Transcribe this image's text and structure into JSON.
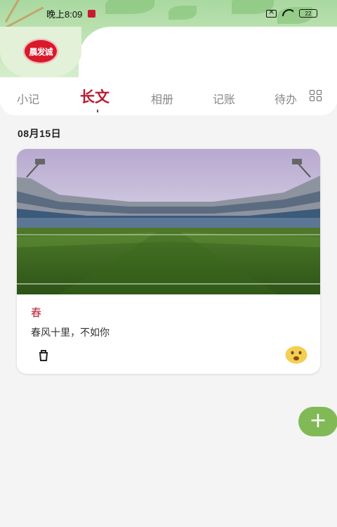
{
  "status_bar": {
    "time": "晚上8:09",
    "battery": "22"
  },
  "app": {
    "logo_text": "晨发诚"
  },
  "tabs": [
    {
      "label": "小记"
    },
    {
      "label": "长文"
    },
    {
      "label": "相册"
    },
    {
      "label": "记账"
    },
    {
      "label": "待办"
    }
  ],
  "active_tab": "长文",
  "entries": {
    "date": "08月15日",
    "items": [
      {
        "title": "春",
        "body": "春风十里，不如你",
        "image": "soccer-stadium-photo",
        "mood_icon": "smiling-face-icon"
      }
    ]
  },
  "fab": {
    "symbol": "+"
  },
  "colors": {
    "accent": "#b91c33",
    "fab": "#82b957",
    "header_green": "#a9d8a0",
    "background": "#f4f4f4"
  }
}
